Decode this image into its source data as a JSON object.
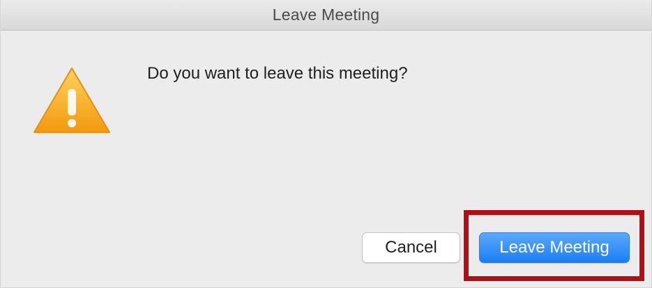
{
  "window": {
    "title": "Leave Meeting"
  },
  "dialog": {
    "icon": "warning-icon",
    "message": "Do you want to leave this meeting?",
    "buttons": {
      "cancel_label": "Cancel",
      "leave_label": "Leave Meeting"
    }
  },
  "colors": {
    "primary_button": "#1c7ef3",
    "highlight_border": "#b30d16",
    "warning_icon": "#f7a614"
  }
}
